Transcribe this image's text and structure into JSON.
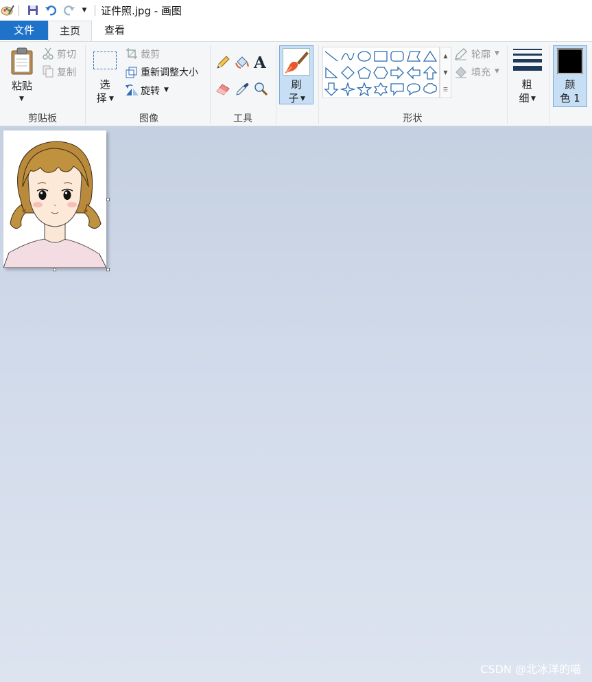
{
  "window": {
    "title": "证件照.jpg - 画图"
  },
  "tabs": [
    {
      "label": "文件"
    },
    {
      "label": "主页"
    },
    {
      "label": "查看"
    }
  ],
  "clipboard": {
    "paste_label": "粘贴",
    "cut_label": "剪切",
    "copy_label": "复制",
    "group_label": "剪贴板"
  },
  "image": {
    "select_label_1": "选",
    "select_label_2": "择",
    "crop_label": "裁剪",
    "resize_label": "重新调整大小",
    "rotate_label": "旋转",
    "group_label": "图像"
  },
  "tools": {
    "group_label": "工具"
  },
  "brushes": {
    "label_1": "刷",
    "label_2": "子"
  },
  "shapes": {
    "outline_label": "轮廓",
    "fill_label": "填充",
    "group_label": "形状"
  },
  "size": {
    "label_1": "粗",
    "label_2": "细"
  },
  "color1": {
    "label_1": "颜",
    "label_2": "色 1",
    "value": "#000000"
  },
  "watermark": "CSDN @北冰洋的喵",
  "colors": {
    "file_tab": "#1e73c9",
    "selected_button": "#c7dff5",
    "shape_stroke": "#2b6cb0"
  }
}
